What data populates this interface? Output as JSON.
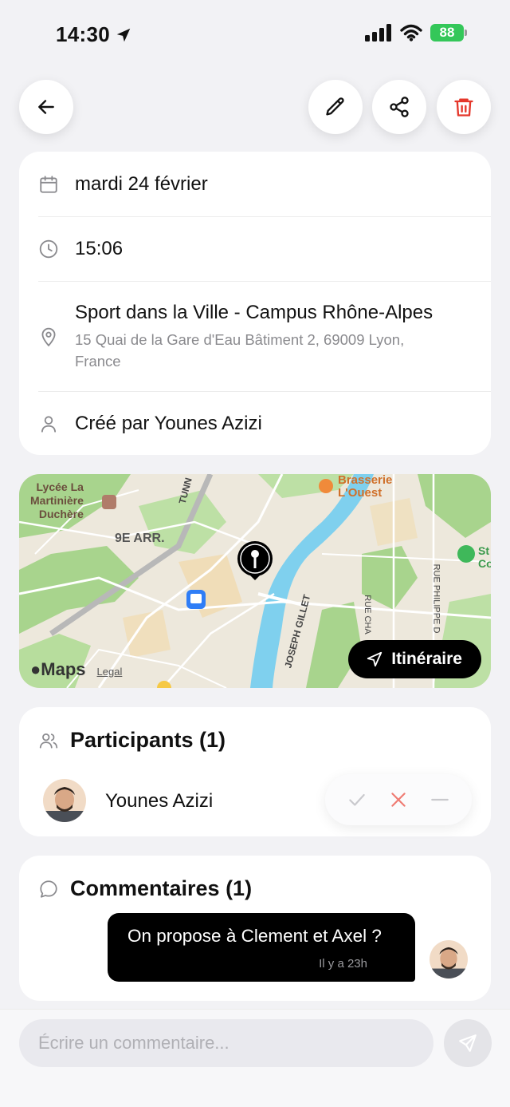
{
  "status_bar": {
    "time": "14:30",
    "battery": "88"
  },
  "event": {
    "date": "mardi 24 février",
    "time": "15:06",
    "location_name": "Sport dans la Ville - Campus Rhône-Alpes",
    "location_address": "15 Quai de la Gare d'Eau Bâtiment 2, 69009 Lyon, France",
    "creator": "Créé par Younes Azizi"
  },
  "map": {
    "labels": {
      "lycee": "Lycée La Martinière Duchère",
      "lycee_l1": "Lycée La",
      "lycee_l2": "Martinière",
      "lycee_l3": "Duchère",
      "arr": "9E ARR.",
      "brasserie_l1": "Brasserie",
      "brasserie_l2": "L'Ouest",
      "tunnel": "TUNN",
      "street_gillet": "JOSEPH GILLET",
      "street_chaz": "RUE CHA",
      "street_philippe": "RUE PHILIPPE D",
      "park_l1": "St",
      "park_l2": "Co"
    },
    "maps_label": "Maps",
    "legal_label": "Legal",
    "itinerary_label": "Itinéraire"
  },
  "participants": {
    "title": "Participants (1)",
    "items": [
      {
        "name": "Younes Azizi"
      }
    ]
  },
  "comments": {
    "title": "Commentaires (1)",
    "items": [
      {
        "text": "On propose à Clement et Axel ?",
        "time": "Il y a 23h"
      }
    ]
  },
  "composer": {
    "placeholder": "Écrire un commentaire..."
  },
  "colors": {
    "accent": "#000000",
    "delete": "#e5372b",
    "river": "#7fd0ee",
    "battery": "#34c759"
  }
}
